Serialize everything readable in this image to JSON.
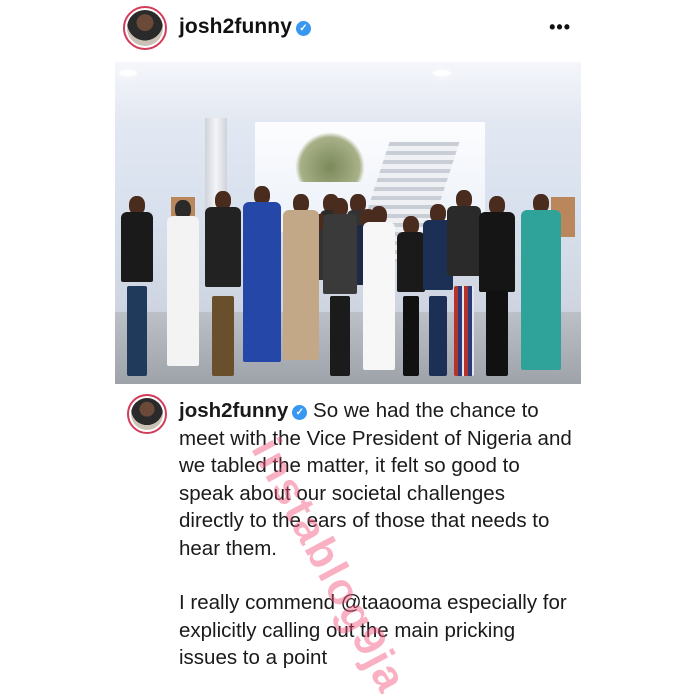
{
  "post": {
    "username": "josh2funny",
    "verified_icon": "✓",
    "more_label": "•••"
  },
  "photo": {
    "alt": "Group photo of people standing in a bright hall"
  },
  "caption": {
    "username": "josh2funny",
    "para1": "So we had the chance to meet with the Vice President of Nigeria and we tabled the matter, it felt so good to speak about our societal challenges directly to the ears of those that needs to hear them.",
    "para2_prefix": "I really commend ",
    "mention": "@taaooma",
    "para2_rest": " especially for explicitly calling out the main pricking issues to a point"
  },
  "watermark": {
    "text": "instablog9ja"
  },
  "colors": {
    "verified": "#3897f0",
    "story_ring": "#d23b5a",
    "watermark": "#f05078"
  },
  "icons": {
    "verified": "verified-badge-icon",
    "more": "more-options-icon"
  }
}
